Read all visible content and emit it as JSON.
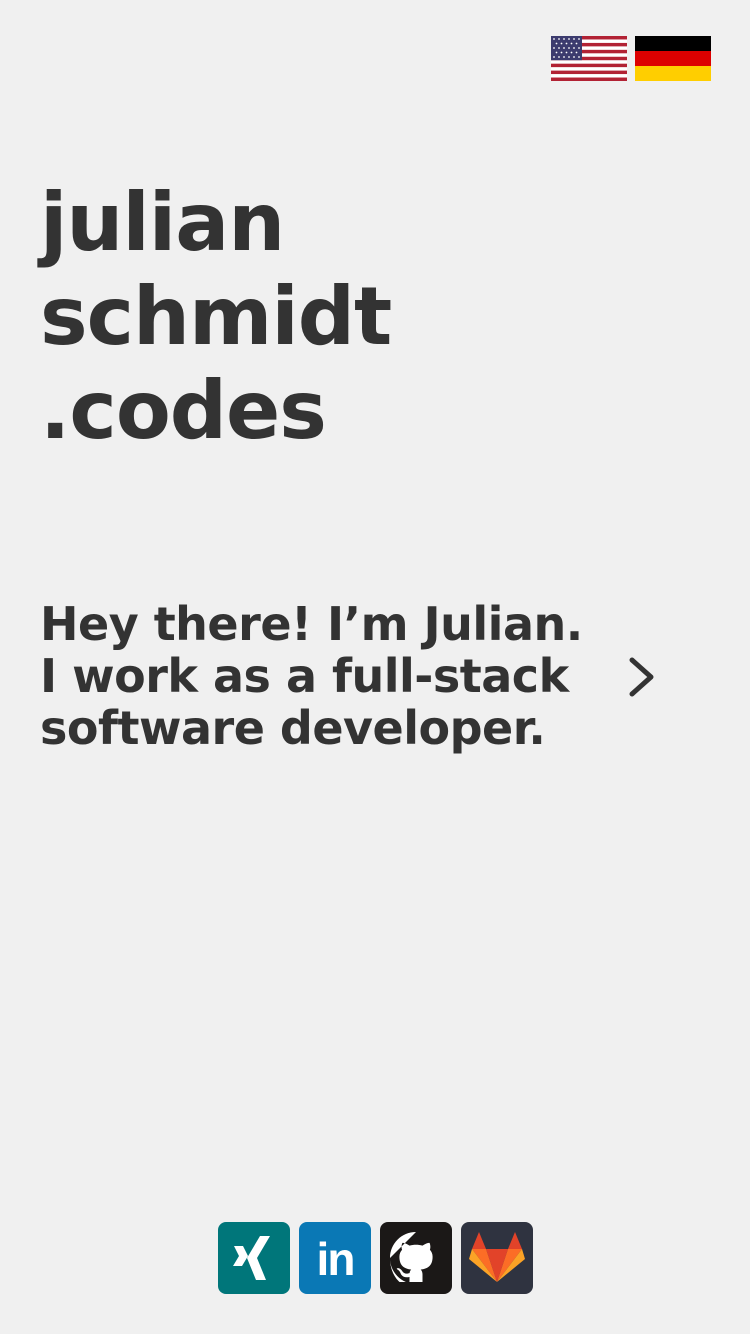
{
  "header": {
    "languages": [
      {
        "code": "en",
        "icon": "us-flag-icon"
      },
      {
        "code": "de",
        "icon": "german-flag-icon"
      }
    ]
  },
  "hero": {
    "title_lines": [
      "julian",
      "schmidt",
      ".codes"
    ]
  },
  "intro": {
    "lines": [
      "Hey there! I’m Julian.",
      "I work as a full-stack",
      "software developer."
    ],
    "next_icon": "chevron-right-icon"
  },
  "socials": [
    {
      "name": "xing",
      "icon": "xing-icon",
      "color": "#00767a"
    },
    {
      "name": "linkedin",
      "icon": "linkedin-icon",
      "label": "in",
      "color": "#0a78b5"
    },
    {
      "name": "github",
      "icon": "github-icon",
      "color": "#1b1817"
    },
    {
      "name": "gitlab",
      "icon": "gitlab-icon",
      "color": "#2f3340"
    }
  ],
  "colors": {
    "background": "#f0f0f0",
    "text": "#333333"
  }
}
